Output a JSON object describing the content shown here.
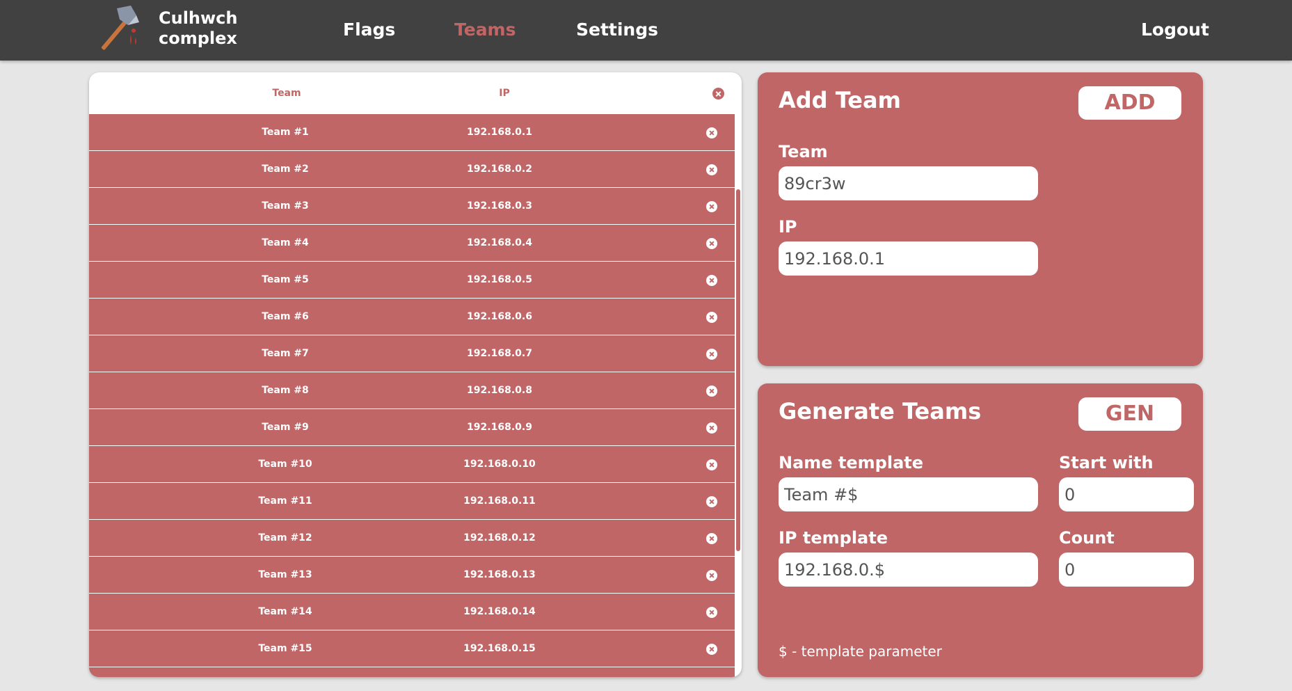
{
  "brand": {
    "line1": "Culhwch",
    "line2": "complex",
    "logo_icon": "axe-icon"
  },
  "nav": [
    {
      "label": "Flags",
      "active": false
    },
    {
      "label": "Teams",
      "active": true
    },
    {
      "label": "Settings",
      "active": false
    }
  ],
  "logout_label": "Logout",
  "table": {
    "headers": {
      "team": "Team",
      "ip": "IP"
    },
    "rows": [
      {
        "team": "Team #1",
        "ip": "192.168.0.1"
      },
      {
        "team": "Team #2",
        "ip": "192.168.0.2"
      },
      {
        "team": "Team #3",
        "ip": "192.168.0.3"
      },
      {
        "team": "Team #4",
        "ip": "192.168.0.4"
      },
      {
        "team": "Team #5",
        "ip": "192.168.0.5"
      },
      {
        "team": "Team #6",
        "ip": "192.168.0.6"
      },
      {
        "team": "Team #7",
        "ip": "192.168.0.7"
      },
      {
        "team": "Team #8",
        "ip": "192.168.0.8"
      },
      {
        "team": "Team #9",
        "ip": "192.168.0.9"
      },
      {
        "team": "Team #10",
        "ip": "192.168.0.10"
      },
      {
        "team": "Team #11",
        "ip": "192.168.0.11"
      },
      {
        "team": "Team #12",
        "ip": "192.168.0.12"
      },
      {
        "team": "Team #13",
        "ip": "192.168.0.13"
      },
      {
        "team": "Team #14",
        "ip": "192.168.0.14"
      },
      {
        "team": "Team #15",
        "ip": "192.168.0.15"
      }
    ]
  },
  "add_team": {
    "title": "Add Team",
    "button": "ADD",
    "team_label": "Team",
    "team_value": "89cr3w",
    "ip_label": "IP",
    "ip_value": "192.168.0.1"
  },
  "generate": {
    "title": "Generate Teams",
    "button": "GEN",
    "name_label": "Name template",
    "name_value": "Team #$",
    "start_label": "Start with",
    "start_value": "0",
    "ip_label": "IP template",
    "ip_value": "192.168.0.$",
    "count_label": "Count",
    "count_value": "0",
    "note": "$ - template parameter"
  },
  "colors": {
    "accent": "#c16666",
    "topbar": "#414141",
    "background": "#e6e6e6"
  }
}
